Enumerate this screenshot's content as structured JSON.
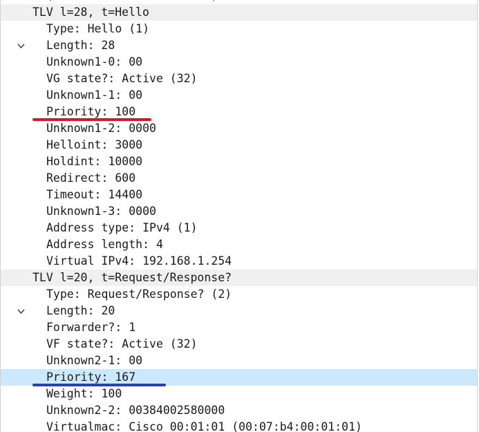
{
  "clipped_top_text": "(                       )",
  "tree": {
    "groups": [
      {
        "label": "TLV l=28, t=Hello",
        "children": [
          "Type: Hello (1)",
          "Length: 28",
          "Unknown1-0: 00",
          "VG state?: Active (32)",
          "Unknown1-1: 00",
          "Priority: 100",
          "Unknown1-2: 0000",
          "Helloint: 3000",
          "Holdint: 10000",
          "Redirect: 600",
          "Timeout: 14400",
          "Unknown1-3: 0000",
          "Address type: IPv4 (1)",
          "Address length: 4",
          "Virtual IPv4: 192.168.1.254"
        ]
      },
      {
        "label": "TLV l=20, t=Request/Response?",
        "children": [
          "Type: Request/Response? (2)",
          "Length: 20",
          "Forwarder?: 1",
          "VF state?: Active (32)",
          "Unknown2-1: 00",
          "Priority: 167",
          "Weight: 100",
          "Unknown2-2: 00384002580000",
          "Virtualmac: Cisco_00:01:01 (00:07:b4:00:01:01)"
        ]
      }
    ],
    "selected_item": "Priority: 167"
  },
  "annotations": {
    "red_underline_color": "#e0102a",
    "blue_underline_color": "#2a3cc6"
  },
  "colors": {
    "header_row_bg": "#f0f0f0",
    "selected_row_bg": "#cce8ff"
  }
}
